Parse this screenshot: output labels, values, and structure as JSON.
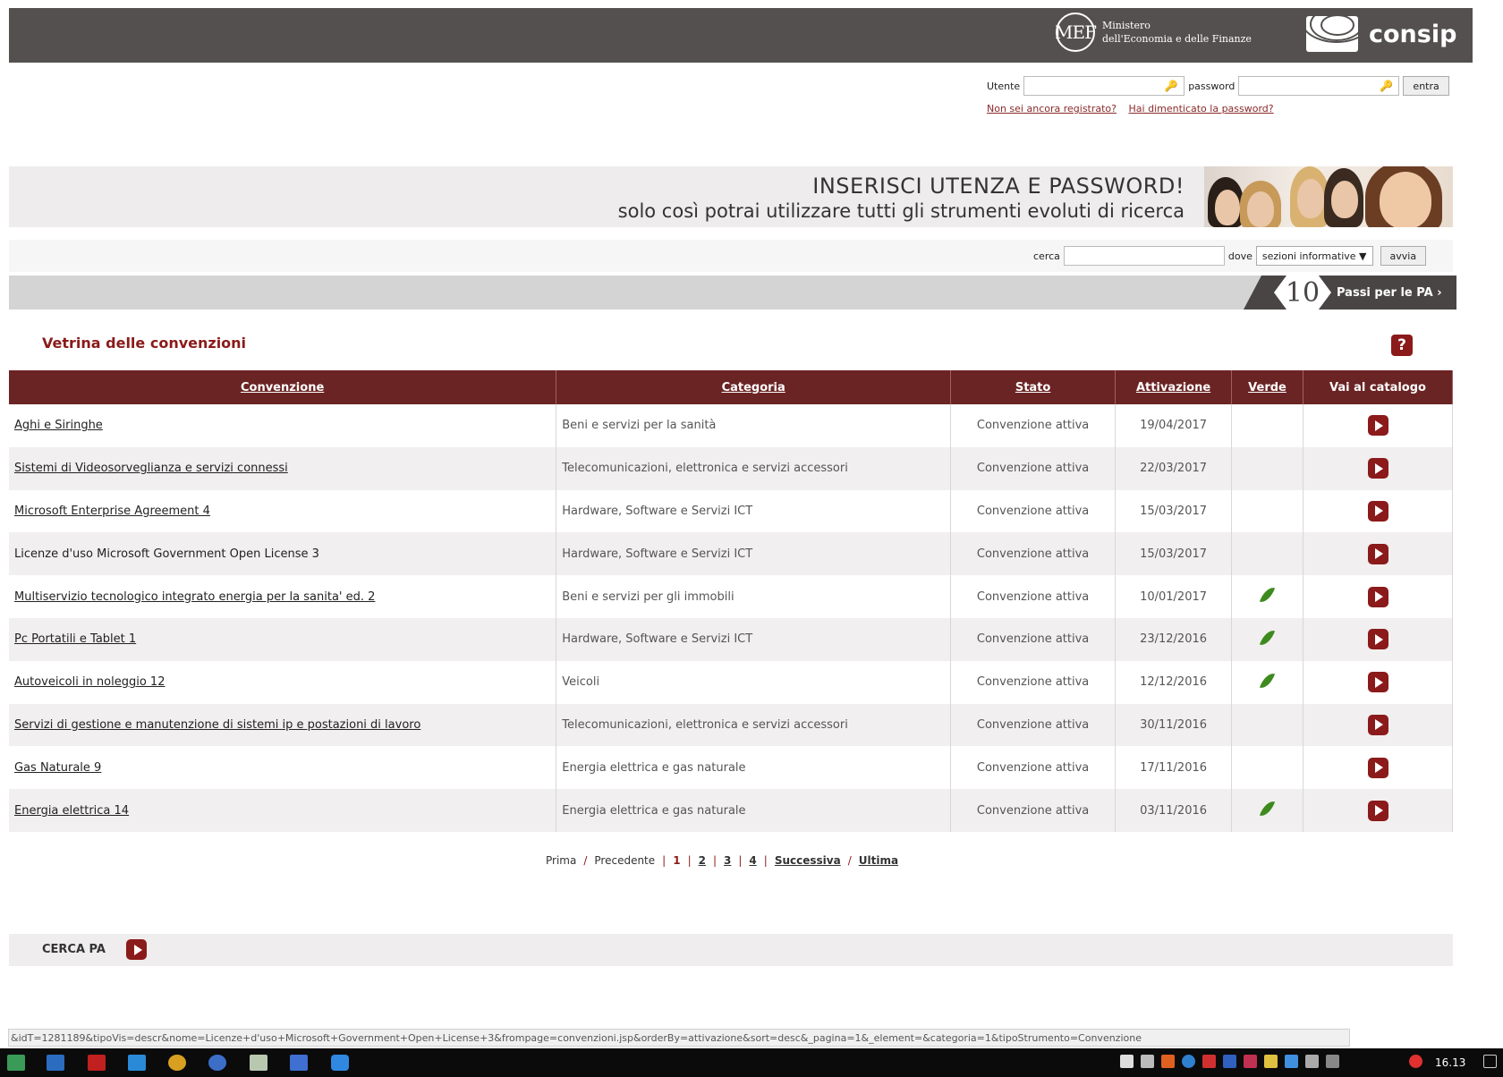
{
  "header": {
    "mef_logo": "MEF",
    "mef_line1": "Ministero",
    "mef_line2": "dell'Economia e delle Finanze",
    "brand": "consip"
  },
  "login": {
    "user_label": "Utente",
    "password_label": "password",
    "submit": "entra",
    "register_link": "Non sei ancora registrato?",
    "forgot_link": "Hai dimenticato la password?"
  },
  "banner": {
    "line1": "INSERISCI UTENZA E PASSWORD!",
    "line2": "solo così potrai utilizzare tutti gli strumenti evoluti di ricerca"
  },
  "search": {
    "label": "cerca",
    "where_label": "dove",
    "where_value": "sezioni informative ▼",
    "submit": "avvia"
  },
  "passi": {
    "number": "10",
    "text": "Passi per le PA ›"
  },
  "page_title": "Vetrina delle convenzioni",
  "help_icon": "?",
  "table": {
    "headers": {
      "convenzione": "Convenzione",
      "categoria": "Categoria",
      "stato": "Stato",
      "attivazione": "Attivazione",
      "verde": "Verde",
      "catalogo": "Vai al catalogo"
    },
    "rows": [
      {
        "name": "Aghi e Siringhe",
        "category": "Beni e servizi per la sanità",
        "status": "Convenzione attiva",
        "date": "19/04/2017",
        "green": false
      },
      {
        "name": "Sistemi di Videosorveglianza e servizi connessi",
        "category": "Telecomunicazioni, elettronica e servizi accessori",
        "status": "Convenzione attiva",
        "date": "22/03/2017",
        "green": false
      },
      {
        "name": "Microsoft Enterprise Agreement 4",
        "category": "Hardware, Software e Servizi ICT",
        "status": "Convenzione attiva",
        "date": "15/03/2017",
        "green": false
      },
      {
        "name": "Licenze d'uso Microsoft Government Open License 3",
        "category": "Hardware, Software e Servizi ICT",
        "status": "Convenzione attiva",
        "date": "15/03/2017",
        "green": false
      },
      {
        "name": "Multiservizio tecnologico integrato energia per la sanita' ed. 2",
        "category": "Beni e servizi per gli immobili",
        "status": "Convenzione attiva",
        "date": "10/01/2017",
        "green": true
      },
      {
        "name": "Pc Portatili e Tablet 1",
        "category": "Hardware, Software e Servizi ICT",
        "status": "Convenzione attiva",
        "date": "23/12/2016",
        "green": true
      },
      {
        "name": "Autoveicoli in noleggio 12",
        "category": "Veicoli",
        "status": "Convenzione attiva",
        "date": "12/12/2016",
        "green": true
      },
      {
        "name": "Servizi di gestione e manutenzione di sistemi ip e postazioni di lavoro",
        "category": "Telecomunicazioni, elettronica e servizi accessori",
        "status": "Convenzione attiva",
        "date": "30/11/2016",
        "green": false
      },
      {
        "name": "Gas Naturale 9",
        "category": "Energia elettrica e gas naturale",
        "status": "Convenzione attiva",
        "date": "17/11/2016",
        "green": false
      },
      {
        "name": "Energia elettrica 14",
        "category": "Energia elettrica e gas naturale",
        "status": "Convenzione attiva",
        "date": "03/11/2016",
        "green": true
      }
    ]
  },
  "pager": {
    "first": "Prima",
    "prev": "Precedente",
    "pages": [
      "1",
      "2",
      "3",
      "4"
    ],
    "current": "1",
    "next": "Successiva",
    "last": "Ultima",
    "slash": "/",
    "bar": "|"
  },
  "cerca_pa": "CERCA PA",
  "status_url": "&idT=1281189&tipoVis=descr&nome=Licenze+d'uso+Microsoft+Government+Open+License+3&frompage=convenzioni.jsp&orderBy=attivazione&sort=desc&_pagina=1&_element=&categoria=1&tipoStrumento=Convenzione",
  "taskbar": {
    "clock": "16.13"
  },
  "colors": {
    "brand_dark": "#6b2424",
    "accent_red": "#8b1a1a",
    "header_grey": "#555050"
  }
}
